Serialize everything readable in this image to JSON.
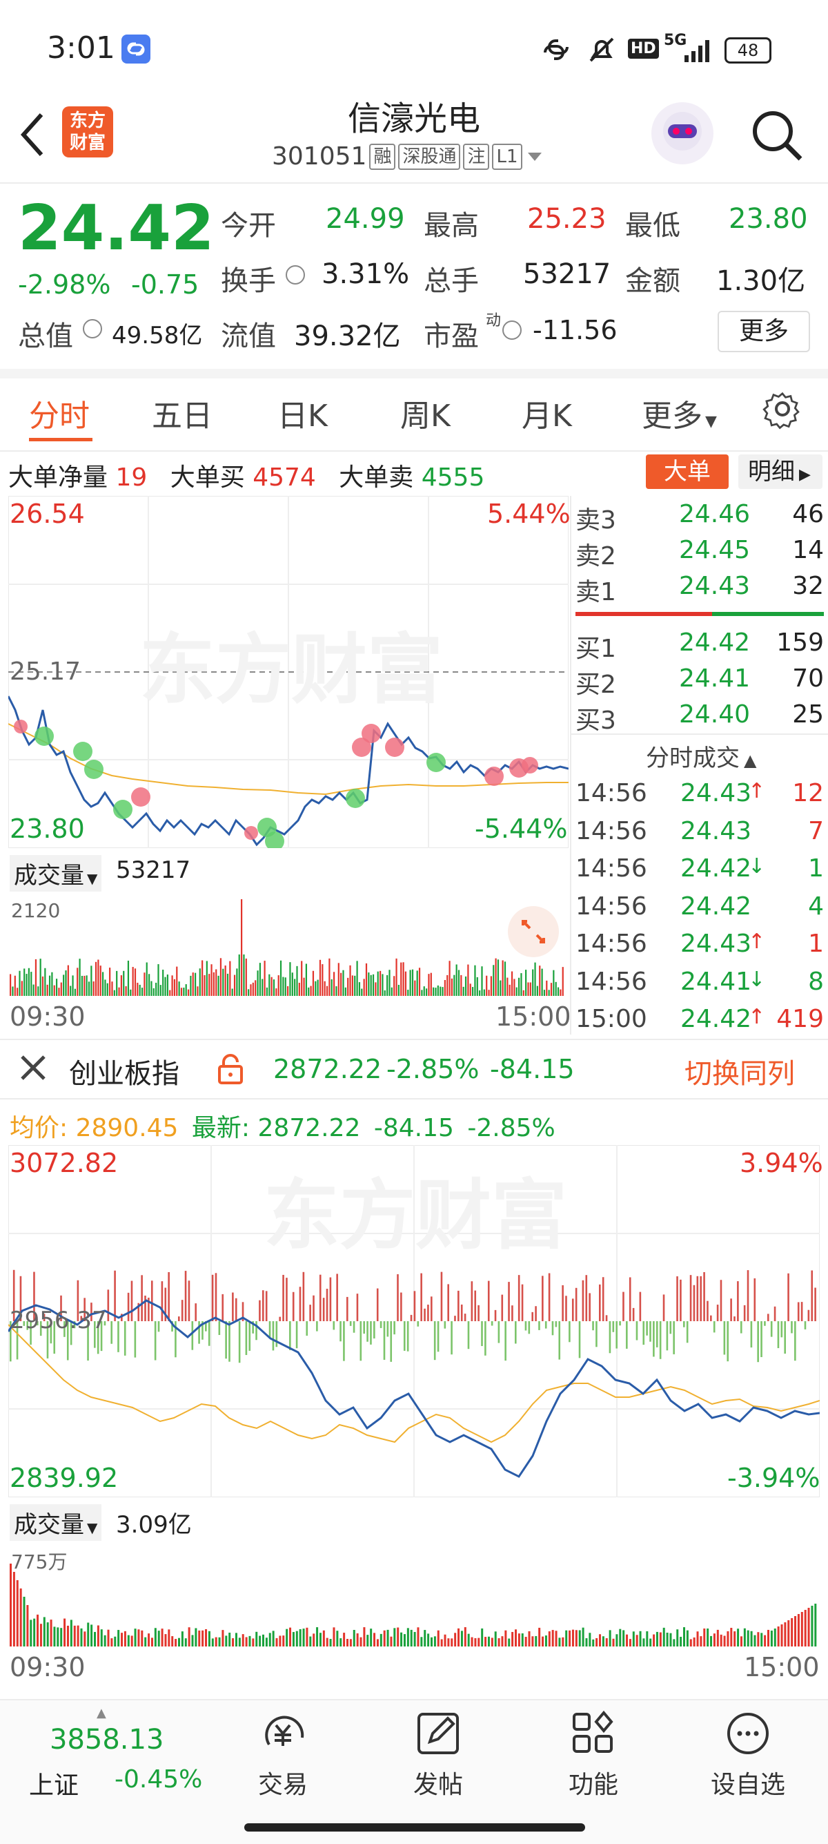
{
  "status_bar": {
    "time": "3:01",
    "network": "5G",
    "hd": "HD",
    "battery": "48"
  },
  "header": {
    "back_icon": "chevron-left-icon",
    "logo_text_line1": "东方",
    "logo_text_line2": "财富",
    "stock_name": "信濠光电",
    "stock_code": "301051",
    "tags": [
      "融",
      "深股通",
      "注",
      "L1"
    ],
    "search_icon": "search-icon",
    "avatar_icon": "robot-avatar-icon"
  },
  "quote": {
    "price": "24.42",
    "change_pct": "-2.98%",
    "change_amt": "-0.75",
    "open_label": "今开",
    "open_value": "24.99",
    "high_label": "最高",
    "high_value": "25.23",
    "low_label": "最低",
    "low_value": "23.80",
    "turnover_label": "换手",
    "turnover_value": "3.31%",
    "volume_label": "总手",
    "volume_value": "53217",
    "amount_label": "金额",
    "amount_value": "1.30亿",
    "mktcap_label": "总值",
    "mktcap_value": "49.58亿",
    "float_label": "流值",
    "float_value": "39.32亿",
    "pe_label": "市盈",
    "pe_sup": "动",
    "pe_value": "-11.56",
    "more_label": "更多"
  },
  "tabs": {
    "items": [
      "分时",
      "五日",
      "日K",
      "周K",
      "月K",
      "更多"
    ],
    "active": "分时",
    "settings_icon": "gear-icon"
  },
  "big_orders": {
    "net_label": "大单净量",
    "net_value": "19",
    "buy_label": "大单买",
    "buy_value": "4574",
    "sell_label": "大单卖",
    "sell_value": "4555",
    "btn_big": "大单",
    "btn_detail": "明细"
  },
  "intraday_chart": {
    "high_price": "26.54",
    "high_pct": "5.44%",
    "prev_close": "25.17",
    "low_price": "23.80",
    "low_pct": "-5.44%",
    "volume_label": "成交量",
    "volume_value": "53217",
    "vol_max": "2120",
    "time_start": "09:30",
    "time_end": "15:00",
    "watermark": "东方财富",
    "expand_icon": "expand-icon"
  },
  "order_book": {
    "asks": [
      {
        "label": "卖3",
        "price": "24.46",
        "qty": "46"
      },
      {
        "label": "卖2",
        "price": "24.45",
        "qty": "14"
      },
      {
        "label": "卖1",
        "price": "24.43",
        "qty": "32"
      }
    ],
    "bids": [
      {
        "label": "买1",
        "price": "24.42",
        "qty": "159"
      },
      {
        "label": "买2",
        "price": "24.41",
        "qty": "70"
      },
      {
        "label": "买3",
        "price": "24.40",
        "qty": "25"
      }
    ],
    "ticks_title": "分时成交",
    "ticks": [
      {
        "time": "14:56",
        "price": "24.43",
        "dir": "↑",
        "qty": "12",
        "color": "#e2342b"
      },
      {
        "time": "14:56",
        "price": "24.43",
        "dir": "",
        "qty": "7",
        "color": "#e2342b"
      },
      {
        "time": "14:56",
        "price": "24.42",
        "dir": "↓",
        "qty": "1",
        "color": "#19a13b"
      },
      {
        "time": "14:56",
        "price": "24.42",
        "dir": "",
        "qty": "4",
        "color": "#19a13b"
      },
      {
        "time": "14:56",
        "price": "24.43",
        "dir": "↑",
        "qty": "1",
        "color": "#e2342b"
      },
      {
        "time": "14:56",
        "price": "24.41",
        "dir": "↓",
        "qty": "8",
        "color": "#19a13b"
      },
      {
        "time": "15:00",
        "price": "24.42",
        "dir": "↑",
        "qty": "419",
        "color": "#e2342b"
      }
    ]
  },
  "index_panel": {
    "close_icon": "close-icon",
    "name": "创业板指",
    "lock_icon": "lock-icon",
    "value": "2872.22",
    "pct": "-2.85%",
    "change": "-84.15",
    "switch_label": "切换同列",
    "avg_label": "均价:",
    "avg_value": "2890.45",
    "latest_label": "最新:",
    "latest_value": "2872.22",
    "latest_change": "-84.15",
    "latest_pct": "-2.85%",
    "high_value": "3072.82",
    "high_pct": "3.94%",
    "mid_value": "2956.37",
    "low_value": "2839.92",
    "low_pct": "-3.94%",
    "volume_label": "成交量",
    "volume_value": "3.09亿",
    "vol_max": "775万",
    "time_start": "09:30",
    "time_end": "15:00",
    "watermark": "东方财富"
  },
  "bottom_nav": {
    "index_value": "3858.13",
    "index_name": "上证",
    "index_pct": "-0.45%",
    "items": [
      {
        "label": "交易",
        "icon": "trade-icon"
      },
      {
        "label": "发帖",
        "icon": "edit-icon"
      },
      {
        "label": "功能",
        "icon": "apps-icon"
      },
      {
        "label": "设自选",
        "icon": "more-icon"
      }
    ]
  },
  "colors": {
    "up": "#e2342b",
    "down": "#19a13b",
    "accent": "#ef5a2a",
    "avg_line": "#f0a020",
    "index_line": "#2a5ca8"
  }
}
